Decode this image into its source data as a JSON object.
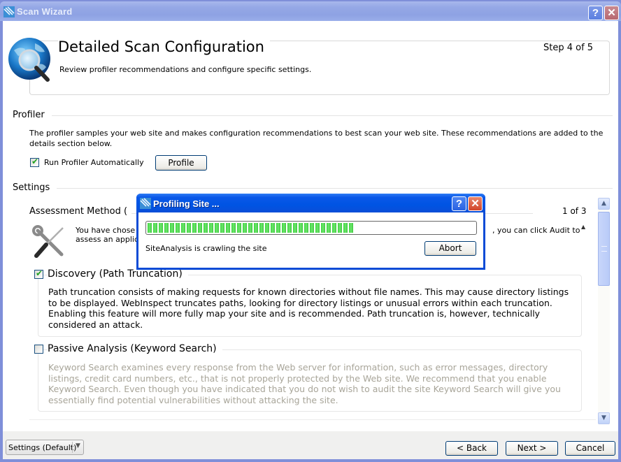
{
  "window": {
    "title": "Scan Wizard",
    "help_button": "?",
    "close_button": "✕"
  },
  "header": {
    "title": "Detailed Scan Configuration",
    "subtitle": "Review profiler recommendations and configure specific settings.",
    "step": "Step 4 of 5"
  },
  "profiler": {
    "section_label": "Profiler",
    "description": "The profiler samples your web site and makes configuration recommendations to best scan your web site. These recommendations are added to the details section below.",
    "run_auto_label": "Run Profiler Automatically",
    "run_auto_checked": true,
    "profile_button": "Profile"
  },
  "settings": {
    "section_label": "Settings",
    "assessment": {
      "label": "Assessment Method (",
      "counter": "1 of 3",
      "text_line1": "You have chose",
      "text_line2": "assess an applic",
      "text_line1_end": ", you can click Audit to"
    },
    "options": [
      {
        "label": "Discovery (Path Truncation)",
        "checked": true,
        "enabled": true,
        "description": "Path truncation consists of making requests for known directories without file names. This may cause directory listings to be displayed. WebInspect truncates paths, looking for directory listings or unusual errors within each truncation. Enabling this feature will more fully map your site and is recommended. Path truncation is, however, technically considered an attack."
      },
      {
        "label": "Passive Analysis (Keyword Search)",
        "checked": false,
        "enabled": false,
        "description": "Keyword Search examines every response from the Web server for information, such as error messages, directory listings, credit card numbers, etc., that is not properly protected by the Web site. We recommend that you enable Keyword Search. Even though you have indicated that you do not wish to audit the site Keyword Search will give you essentially find potential vulnerabilities without attacking the site."
      }
    ],
    "collapse_glyph": "▲"
  },
  "scrollbar": {
    "up_glyph": "▲",
    "down_glyph": "▼"
  },
  "footer": {
    "settings_preset": "Settings (Default)",
    "preset_arrow": "▼",
    "back_button": "< Back",
    "next_button": "Next >",
    "cancel_button": "Cancel"
  },
  "modal": {
    "title": "Profiling Site ...",
    "help_button": "?",
    "close_button": "✕",
    "progress_percent": 63,
    "status_text": "SiteAnalysis is crawling the site",
    "abort_button": "Abort"
  },
  "colors": {
    "titlebar_inactive": "#95a8e6",
    "modal_titlebar": "#0054e3",
    "progress_green": "#3dd43d",
    "disabled_text": "#a8a599"
  }
}
